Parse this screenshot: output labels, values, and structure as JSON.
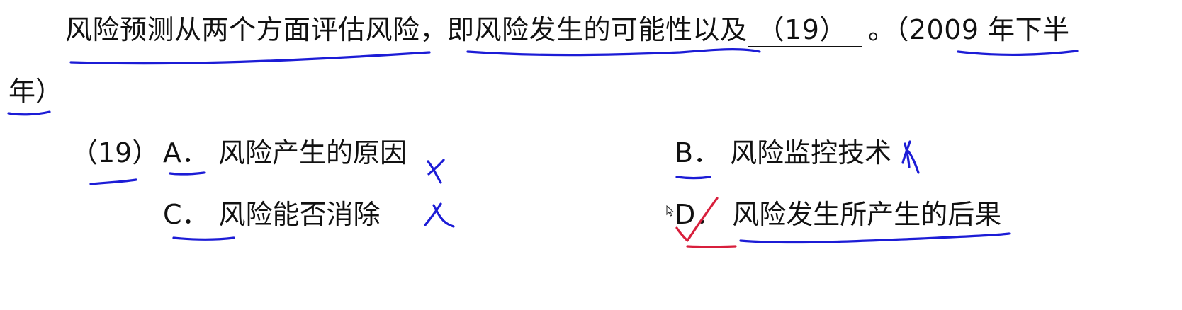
{
  "question": {
    "stem_part1": "风险预测从两个方面评估风险，即风险发生的可能性以及",
    "blank_label": "（19）",
    "stem_part2": "。（2009 年下半",
    "stem_part3": "年）",
    "number_label": "（19）"
  },
  "options": [
    {
      "letter": "A．",
      "text": "风险产生的原因",
      "mark": "cross"
    },
    {
      "letter": "B．",
      "text": "风险监控技术",
      "mark": "cross"
    },
    {
      "letter": "C．",
      "text": "风险能否消除",
      "mark": "cross"
    },
    {
      "letter": "D．",
      "text": "风险发生所产生的后果",
      "mark": "check"
    }
  ],
  "annotations": {
    "pen_blue": "#1c1cd6",
    "pen_red": "#d81f3c",
    "icons": [
      "cross-mark-icon",
      "check-mark-icon",
      "mouse-cursor-icon"
    ]
  }
}
